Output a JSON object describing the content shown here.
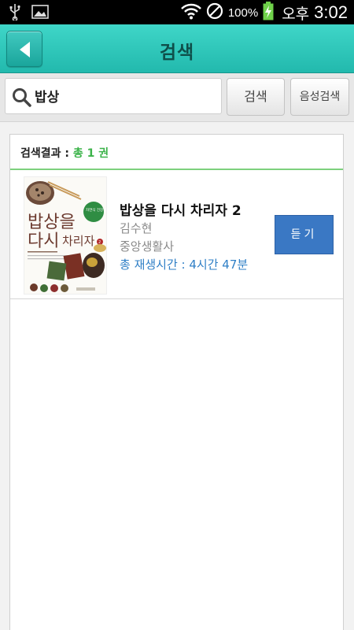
{
  "status_bar": {
    "battery_percent": "100%",
    "ampm": "오후",
    "time": "3:02"
  },
  "header": {
    "title": "검색"
  },
  "search": {
    "query": "밥상",
    "search_button": "검색",
    "voice_search_button": "음성검색"
  },
  "results": {
    "summary_label": "검색결과 : ",
    "summary_count": "총 1 권",
    "items": [
      {
        "title": "밥상을 다시 차리자 2",
        "author": "김수현",
        "publisher": "중앙생활사",
        "play_time": "총 재생시간 : 4시간 47분",
        "listen_label": "듣기",
        "cover": {
          "line1": "밥상을",
          "line2": "다시",
          "line3": "차리자",
          "badge": "자연식 건강법",
          "volume": "2"
        }
      }
    ]
  },
  "colors": {
    "header_teal": "#2cc4b8",
    "summary_green": "#3cb34a",
    "play_time_blue": "#2f7fc6",
    "listen_button_blue": "#3a78c4"
  }
}
